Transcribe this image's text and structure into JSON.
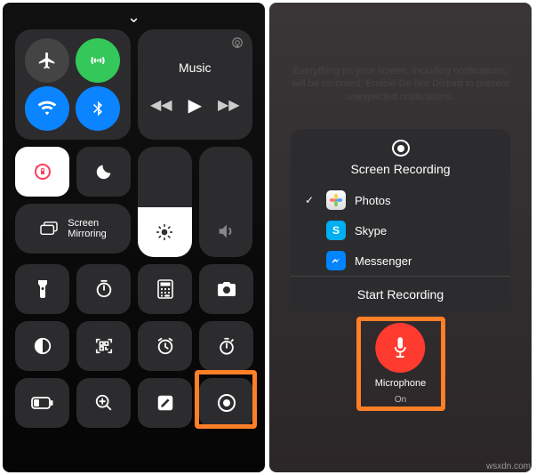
{
  "left": {
    "connectivity": {
      "airplane": "airplane-icon",
      "cellular": "cellular-icon",
      "wifi": "wifi-icon",
      "bluetooth": "bluetooth-icon"
    },
    "music": {
      "title": "Music",
      "airplay": "airplay-icon"
    },
    "orientation_lock": "orientation-lock-icon",
    "dnd": "dnd-moon-icon",
    "screen_mirroring": {
      "label": "Screen\nMirroring"
    },
    "brightness": {
      "icon": "brightness-icon",
      "level_pct": 45
    },
    "volume": {
      "icon": "volume-icon",
      "level_pct": 0
    },
    "row3": {
      "flashlight": "flashlight-icon",
      "timer": "timer-icon",
      "calculator": "calculator-icon",
      "camera": "camera-icon"
    },
    "row4": {
      "dark_mode": "dark-mode-icon",
      "qr": "qr-scan-icon",
      "alarm": "alarm-icon",
      "stopwatch": "stopwatch-icon"
    },
    "row5": {
      "low_power": "low-power-icon",
      "magnifier": "magnifier-icon",
      "notes": "notes-compose-icon",
      "screen_record": "screen-record-icon"
    }
  },
  "right": {
    "notice": "Everything on your screen, including notifications, will be recorded. Enable Do Not Disturb to prevent unexpected notifications.",
    "modal": {
      "title": "Screen Recording",
      "options": [
        {
          "label": "Photos",
          "selected": true,
          "icon": "photos"
        },
        {
          "label": "Skype",
          "selected": false,
          "icon": "skype"
        },
        {
          "label": "Messenger",
          "selected": false,
          "icon": "messenger"
        }
      ],
      "start_label": "Start Recording"
    },
    "mic": {
      "label": "Microphone",
      "state": "On"
    }
  },
  "watermark": "wsxdn.com",
  "highlight_color": "#ff7f27"
}
